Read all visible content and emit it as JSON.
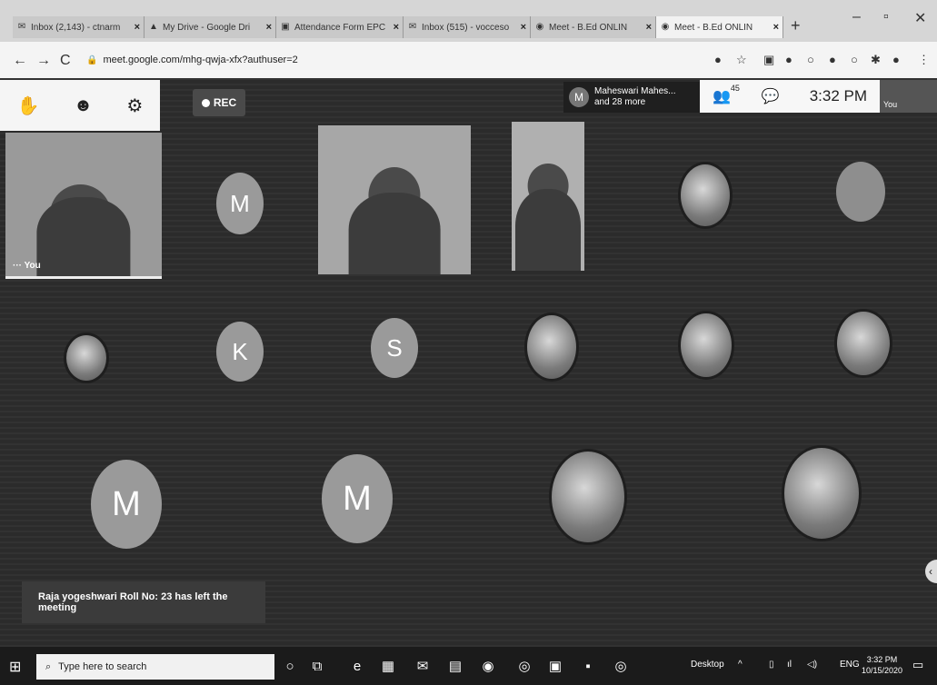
{
  "browser": {
    "tabs": [
      {
        "title": "Inbox (2,143) - ctnarm",
        "icon": "gmail-icon"
      },
      {
        "title": "My Drive - Google Dri",
        "icon": "drive-icon"
      },
      {
        "title": "Attendance Form EPC",
        "icon": "forms-icon"
      },
      {
        "title": "Inbox (515) - vocceso",
        "icon": "gmail-icon"
      },
      {
        "title": "Meet - B.Ed ONLIN",
        "icon": "meet-icon"
      },
      {
        "title": "Meet - B.Ed ONLIN",
        "icon": "meet-icon",
        "active": true
      }
    ],
    "url": "meet.google.com/mhg-qwja-xfx?authuser=2"
  },
  "meet": {
    "rec_label": "REC",
    "presenter": {
      "initial": "M",
      "line1": "Maheswari Mahes...",
      "line2": "and 28 more"
    },
    "participant_count": "45",
    "clock": "3:32 PM",
    "self_label": "You",
    "toast": "Raja yogeshwari Roll No: 23 has left the meeting",
    "avatars": [
      {
        "initial": "M"
      },
      {
        "initial": "K"
      },
      {
        "initial": "S"
      },
      {
        "initial": "M"
      },
      {
        "initial": "M"
      }
    ]
  },
  "taskbar": {
    "search_placeholder": "Type here to search",
    "desktop_label": "Desktop",
    "lang": "ENG",
    "time": "3:32 PM",
    "date": "10/15/2020"
  }
}
